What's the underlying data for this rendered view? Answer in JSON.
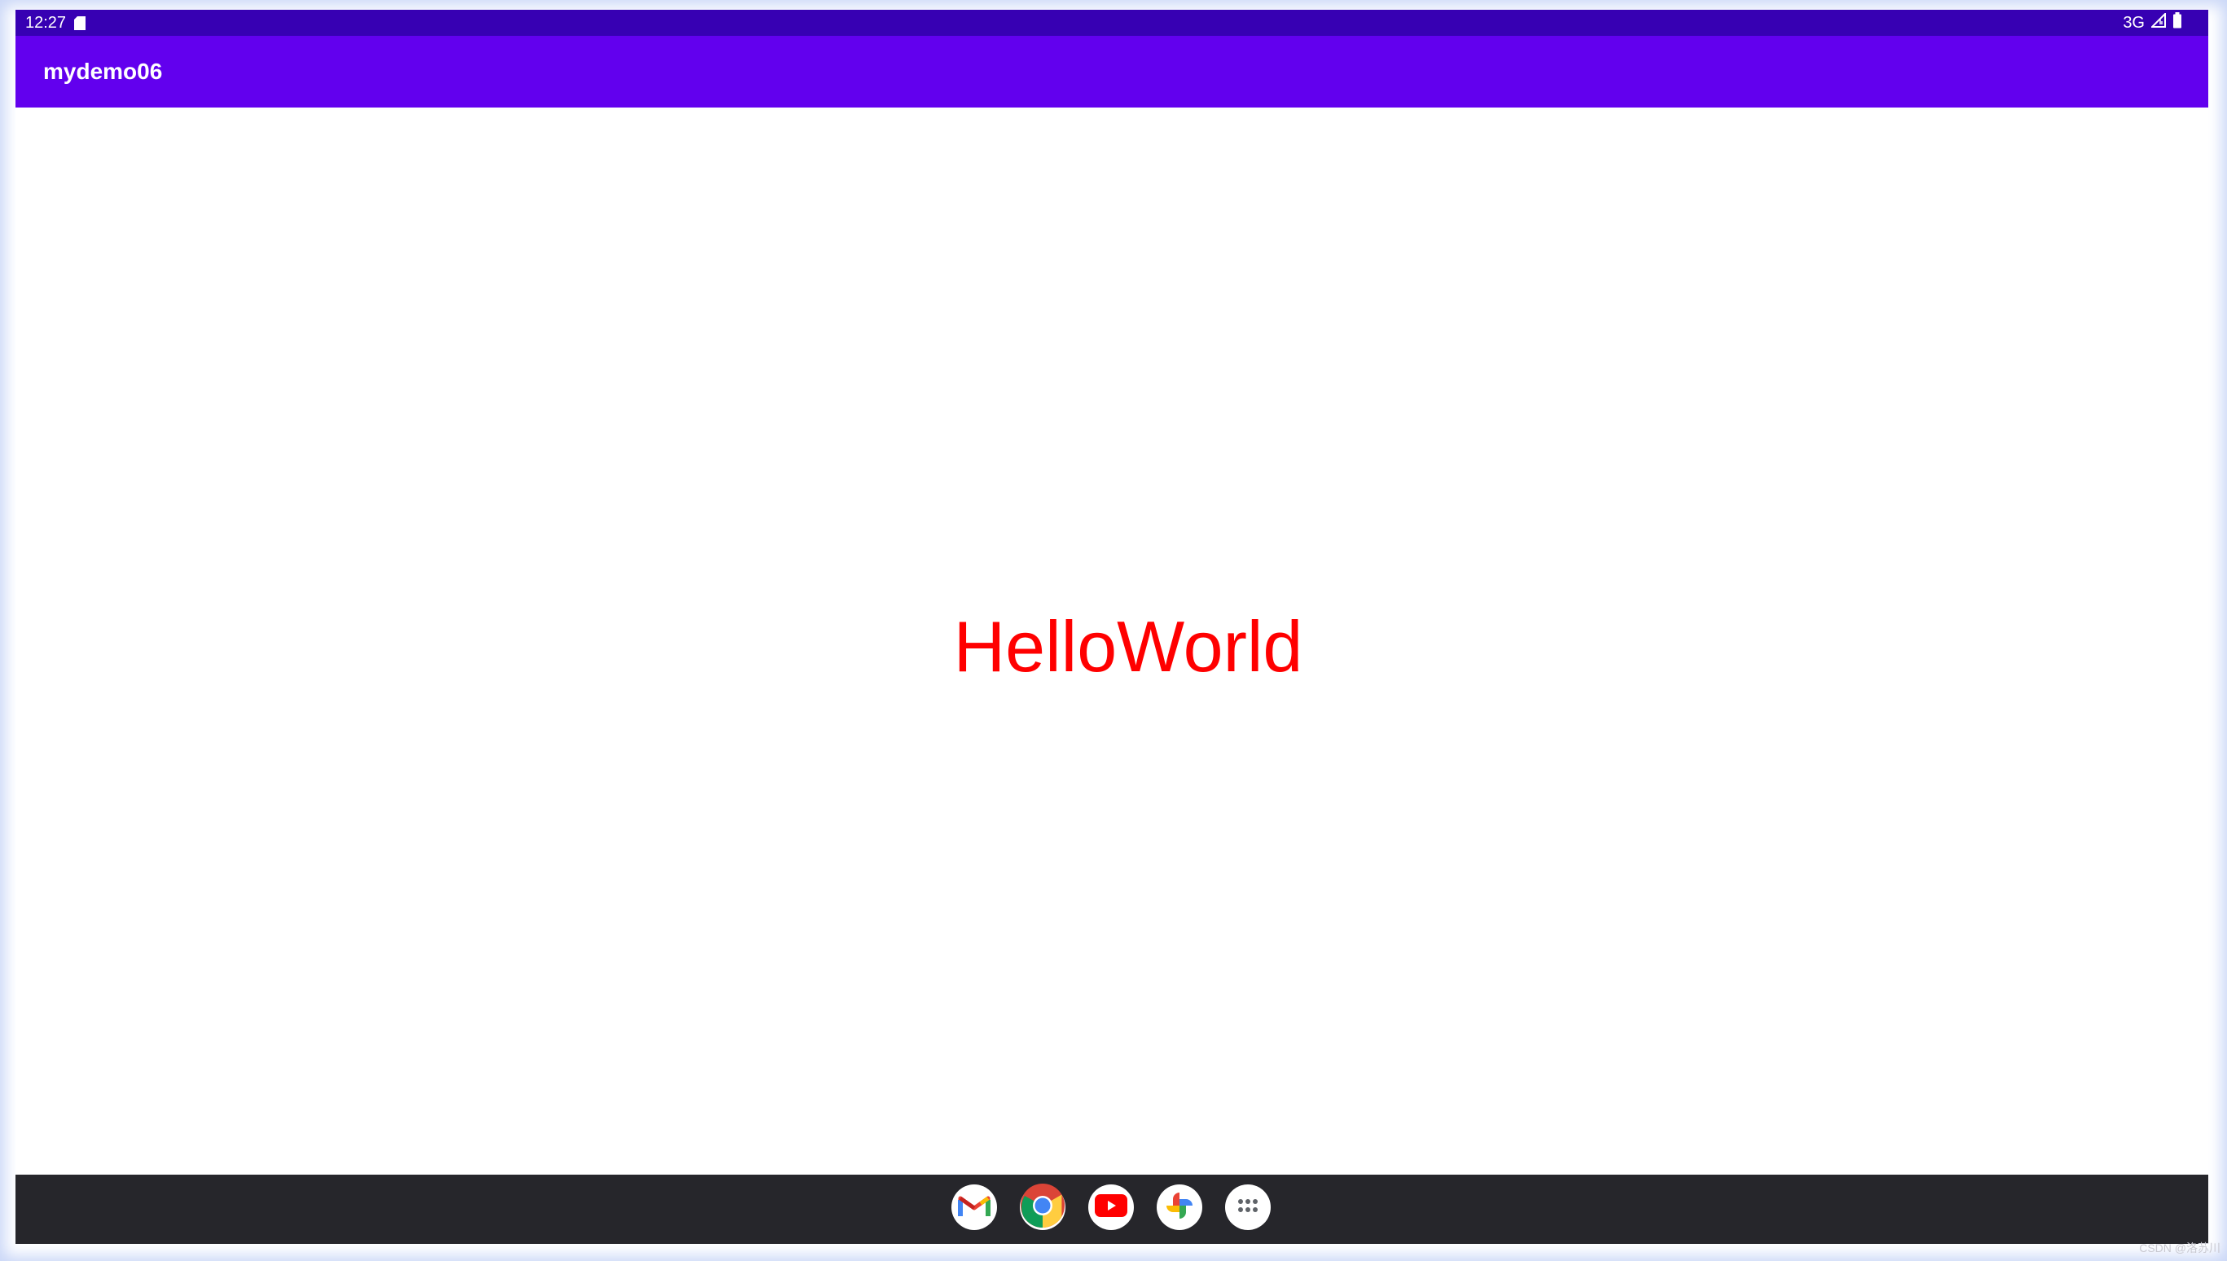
{
  "status_bar": {
    "time": "12:27",
    "network": "3G",
    "icons": [
      "sd-card-icon",
      "signal-icon",
      "battery-icon"
    ]
  },
  "app_bar": {
    "title": "mydemo06",
    "color": "#6200ee"
  },
  "content": {
    "text": "HelloWorld",
    "text_color": "#ff0000"
  },
  "taskbar": {
    "apps": [
      {
        "name": "Gmail",
        "icon": "gmail-icon"
      },
      {
        "name": "Chrome",
        "icon": "chrome-icon"
      },
      {
        "name": "YouTube",
        "icon": "youtube-icon"
      },
      {
        "name": "Photos",
        "icon": "photos-icon"
      },
      {
        "name": "App drawer",
        "icon": "app-drawer-icon"
      }
    ]
  },
  "colors": {
    "status_bar": "#3700b3",
    "app_bar": "#6200ee",
    "taskbar": "#26262b"
  },
  "watermark": "CSDN @洛苏川"
}
